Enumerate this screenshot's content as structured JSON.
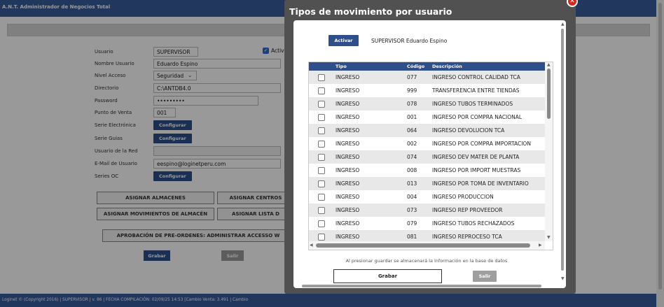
{
  "app": {
    "title": "A.N.T. Administrador de Negocios Total",
    "footer": "Loginet © (Copyright 2016) | SUPERVISOR | v. 86 | FECHA COMPILACIÓN: 02/09/25 14:53 [Cambio Venta: 3.491 | Cambio"
  },
  "form": {
    "fields": [
      {
        "label": "Usuario",
        "value": "SUPERVISOR"
      },
      {
        "label": "Nombre Usuario",
        "value": "Eduardo Espino"
      },
      {
        "label": "Nivel Acceso",
        "value": "Seguridad"
      },
      {
        "label": "Directorio",
        "value": "C:\\ANTDB4.0"
      },
      {
        "label": "Password",
        "value": "•••••••••"
      },
      {
        "label": "Punto de Venta",
        "value": "001"
      },
      {
        "label": "Serie Electrónica",
        "button": "Configurar"
      },
      {
        "label": "Serie Guias",
        "button": "Configurar"
      },
      {
        "label": "Usuario de la Red",
        "value": ""
      },
      {
        "label": "E-Mail de Usuario",
        "value": "eespino@loginetperu.com"
      },
      {
        "label": "Series OC",
        "button": "Configurar"
      }
    ],
    "activo_label": "Activ",
    "buttons": {
      "asignar_almacenes": "ASIGNAR ALMACENES",
      "asignar_centros": "ASIGNAR CENTROS",
      "asignar_movimientos": "ASIGNAR MOVIMIENTOS DE ALMACÉN",
      "asignar_lista": "ASIGNAR LISTA D",
      "aprobacion": "APROBACIÓN DE PRE-ORDENES: ADMINISTRAR ACCESSO W",
      "grabar": "Grabar",
      "salir": "Salir"
    }
  },
  "modal": {
    "title": "Tipos de movimiento por usuario",
    "close_icon": "close-icon",
    "activar_label": "Activar",
    "user_label": "SUPERVISOR  Eduardo Espino",
    "columns": [
      "Tipo",
      "Código",
      "Descripción"
    ],
    "rows": [
      {
        "tipo": "INGRESO",
        "codigo": "077",
        "descripcion": "INGRESO CONTROL CALIDAD TCA"
      },
      {
        "tipo": "INGRESO",
        "codigo": "999",
        "descripcion": "TRANSFERENCIA ENTRE TIENDAS"
      },
      {
        "tipo": "INGRESO",
        "codigo": "078",
        "descripcion": "INGRESO TUBOS TERMINADOS"
      },
      {
        "tipo": "INGRESO",
        "codigo": "001",
        "descripcion": "INGRESO POR COMPRA NACIONAL"
      },
      {
        "tipo": "INGRESO",
        "codigo": "064",
        "descripcion": "INGRESO DEVOLUCION TCA"
      },
      {
        "tipo": "INGRESO",
        "codigo": "002",
        "descripcion": "INGRESO POR COMPRA IMPORTACION"
      },
      {
        "tipo": "INGRESO",
        "codigo": "074",
        "descripcion": "INGRESO DEV MATER DE PLANTA"
      },
      {
        "tipo": "INGRESO",
        "codigo": "008",
        "descripcion": "INGRESO POR IMPORT MUESTRAS"
      },
      {
        "tipo": "INGRESO",
        "codigo": "013",
        "descripcion": "INGRESO POR TOMA DE INVENTARIO"
      },
      {
        "tipo": "INGRESO",
        "codigo": "004",
        "descripcion": "INGRESO PRODUCCION"
      },
      {
        "tipo": "INGRESO",
        "codigo": "073",
        "descripcion": "INGRESO REP PROVEEDOR"
      },
      {
        "tipo": "INGRESO",
        "codigo": "079",
        "descripcion": "INGRESO TUBOS RECHAZADOS"
      },
      {
        "tipo": "INGRESO",
        "codigo": "081",
        "descripcion": "INGRESO REPROCESO TCA"
      }
    ],
    "save_note": "Al presionar guardar se almacenará la información en la base de datos",
    "grabar_label": "Grabar",
    "salir_label": "Salir"
  }
}
